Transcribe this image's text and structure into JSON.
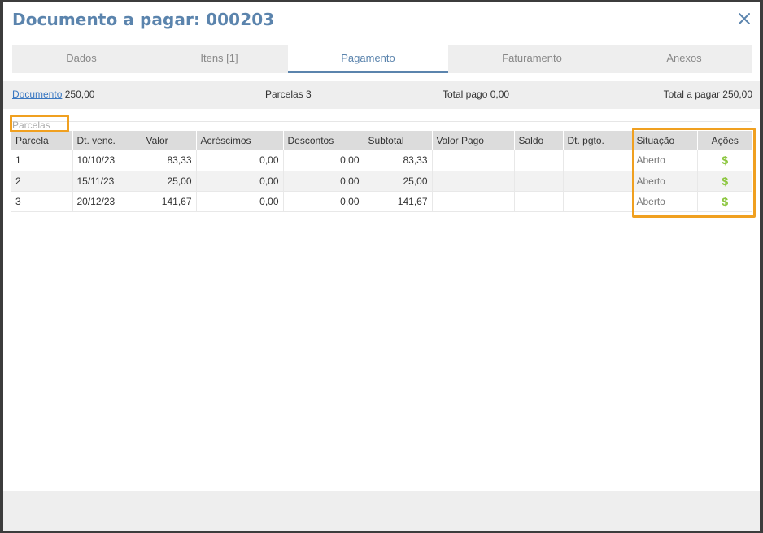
{
  "header": {
    "title": "Documento a pagar: 000203"
  },
  "colors": {
    "accent": "#5b84ad",
    "link": "#3a78c2",
    "action": "#8cc63f",
    "highlight": "#f0a020"
  },
  "tabs": [
    {
      "label": "Dados",
      "active": false
    },
    {
      "label": "Itens [1]",
      "active": false
    },
    {
      "label": "Pagamento",
      "active": true
    },
    {
      "label": "Faturamento",
      "active": false
    },
    {
      "label": "Anexos",
      "active": false
    }
  ],
  "summary": {
    "documento_link": "Documento",
    "documento_value": "250,00",
    "parcelas": "Parcelas 3",
    "total_pago": "Total pago 0,00",
    "total_a_pagar": "Total a pagar 250,00"
  },
  "section": {
    "label": "Parcelas"
  },
  "table": {
    "columns": [
      "Parcela",
      "Dt. venc.",
      "Valor",
      "Acréscimos",
      "Descontos",
      "Subtotal",
      "Valor Pago",
      "Saldo",
      "Dt. pgto.",
      "Situação",
      "Ações"
    ],
    "rows": [
      {
        "parcela": "1",
        "dt_venc": "10/10/23",
        "valor": "83,33",
        "acrescimos": "0,00",
        "descontos": "0,00",
        "subtotal": "83,33",
        "valor_pago": "",
        "saldo": "",
        "dt_pgto": "",
        "situacao": "Aberto",
        "acao": "$"
      },
      {
        "parcela": "2",
        "dt_venc": "15/11/23",
        "valor": "25,00",
        "acrescimos": "0,00",
        "descontos": "0,00",
        "subtotal": "25,00",
        "valor_pago": "",
        "saldo": "",
        "dt_pgto": "",
        "situacao": "Aberto",
        "acao": "$"
      },
      {
        "parcela": "3",
        "dt_venc": "20/12/23",
        "valor": "141,67",
        "acrescimos": "0,00",
        "descontos": "0,00",
        "subtotal": "141,67",
        "valor_pago": "",
        "saldo": "",
        "dt_pgto": "",
        "situacao": "Aberto",
        "acao": "$"
      }
    ]
  }
}
